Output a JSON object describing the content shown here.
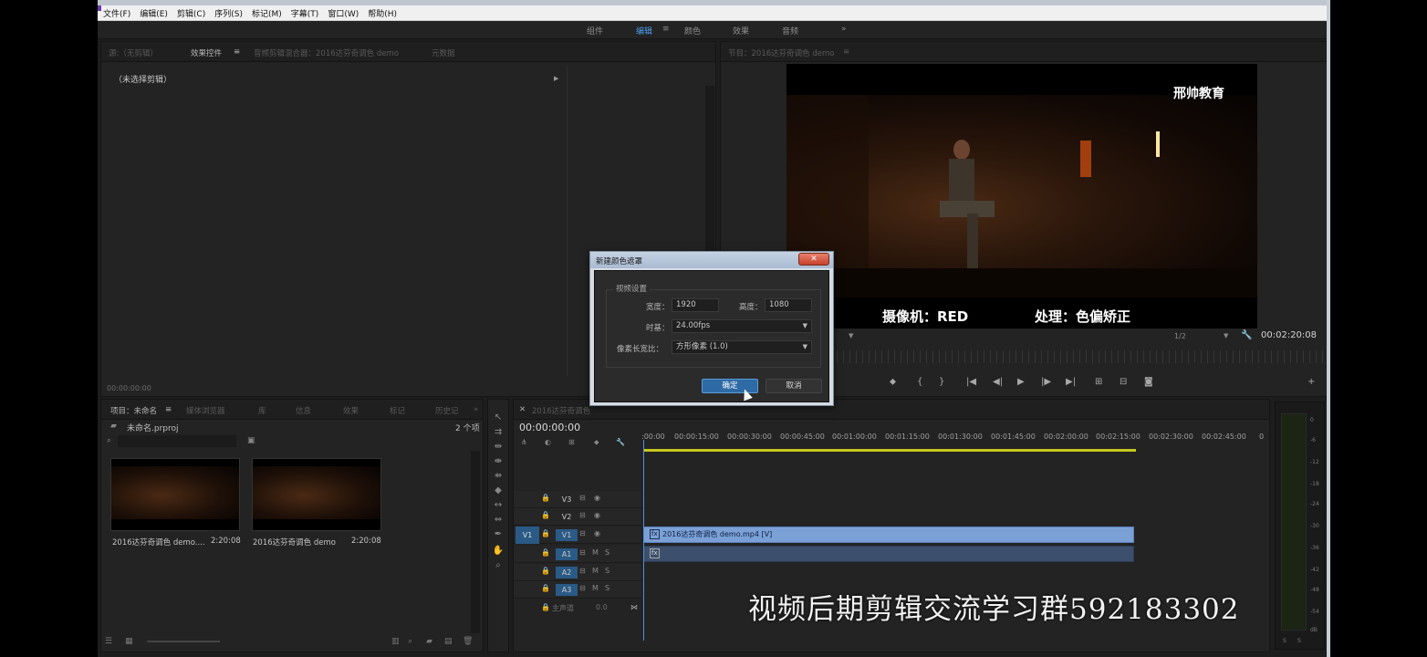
{
  "menu": [
    "文件(F)",
    "编辑(E)",
    "剪辑(C)",
    "序列(S)",
    "标记(M)",
    "字幕(T)",
    "窗口(W)",
    "帮助(H)"
  ],
  "workspaces": {
    "items": [
      "组件",
      "编辑",
      "颜色",
      "效果",
      "音频"
    ],
    "active": "编辑",
    "more": "»"
  },
  "effect_panel": {
    "tabs": [
      "源:（无剪辑）",
      "效果控件",
      "音频剪辑混合器：2016达芬奇调色 demo",
      "元数据"
    ],
    "empty_text": "（未选择剪辑）",
    "timecode": "00:00:00:00"
  },
  "program_monitor": {
    "tab": "节目：2016达芬奇调色 demo",
    "brand": "邢帅教育",
    "subtitle_left": "摄像机：RED",
    "subtitle_right": "处理：色偏矫正",
    "resolution": "1/2",
    "timecode": "00:02:20:08"
  },
  "project_panel": {
    "tabs": [
      "项目：未命名",
      "媒体浏览器",
      "库",
      "信息",
      "效果",
      "标记",
      "历史记"
    ],
    "project_file": "未命名.prproj",
    "item_count": "2 个项",
    "items": [
      {
        "name": "2016达芬奇调色 demo....",
        "duration": "2:20:08"
      },
      {
        "name": "2016达芬奇调色 demo",
        "duration": "2:20:08"
      }
    ]
  },
  "timeline": {
    "tab": "2016达芬奇调色",
    "timecode": "00:00:00:00",
    "ruler": [
      ":00:00",
      "00:00:15:00",
      "00:00:30:00",
      "00:00:45:00",
      "00:01:00:00",
      "00:01:15:00",
      "00:01:30:00",
      "00:01:45:00",
      "00:02:00:00",
      "00:02:15:00",
      "00:02:30:00",
      "00:02:45:00",
      "0"
    ],
    "video_tracks": [
      "V3",
      "V2",
      "V1"
    ],
    "audio_tracks": [
      "A1",
      "A2",
      "A3"
    ],
    "source_patch": "V1",
    "master_label": "主声道",
    "master_value": "0.0",
    "clip_video": "2016达芬奇调色 demo.mp4 [V]",
    "track_m": "M",
    "track_s": "S"
  },
  "audio_meter": {
    "labels": [
      "0",
      "-6",
      "-12",
      "-18",
      "-24",
      "-30",
      "-36",
      "-42",
      "-48",
      "-54",
      "dB"
    ],
    "footer": [
      "S",
      "S"
    ]
  },
  "dialog": {
    "title": "新建颜色遮罩",
    "group_title": "视频设置",
    "width_label": "宽度：",
    "width_value": "1920",
    "height_label": "高度：",
    "height_value": "1080",
    "timebase_label": "时基：",
    "timebase_value": "24.00fps",
    "pixel_label": "像素长宽比：",
    "pixel_value": "方形像素 (1.0)",
    "ok": "确定",
    "cancel": "取消",
    "close": "✕"
  },
  "watermark": "视频后期剪辑交流学习群592183302"
}
